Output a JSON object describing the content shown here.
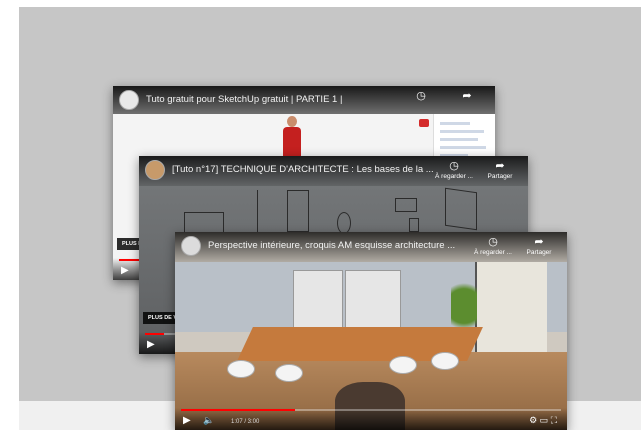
{
  "colors": {
    "panel": "#c6c6c6",
    "strip": "#f0f0f0",
    "progress": "#ff0000"
  },
  "videos": [
    {
      "title": "Tuto gratuit pour SketchUp gratuit | PARTIE 1 |",
      "more_videos": "PLUS DE VIDÉOS",
      "progress_fraction": 0.08
    },
    {
      "title": "[Tuto n°17] TECHNIQUE D'ARCHITECTE : Les bases de la ...",
      "watch_later": "À regarder ...",
      "share": "Partager",
      "more_videos": "PLUS DE VIDÉOS",
      "progress_fraction": 0.05
    },
    {
      "title": "Perspective intérieure, croquis AM esquisse architecture ...",
      "watch_later": "À regarder ...",
      "share": "Partager",
      "time": "1:07 / 3:00",
      "progress_fraction": 0.3
    }
  ],
  "icons": {
    "clock": "clock-icon",
    "share": "share-icon",
    "play": "play-icon",
    "volume": "volume-icon",
    "settings": "gear-icon",
    "cast": "cast-icon",
    "fullscreen": "fullscreen-icon"
  }
}
